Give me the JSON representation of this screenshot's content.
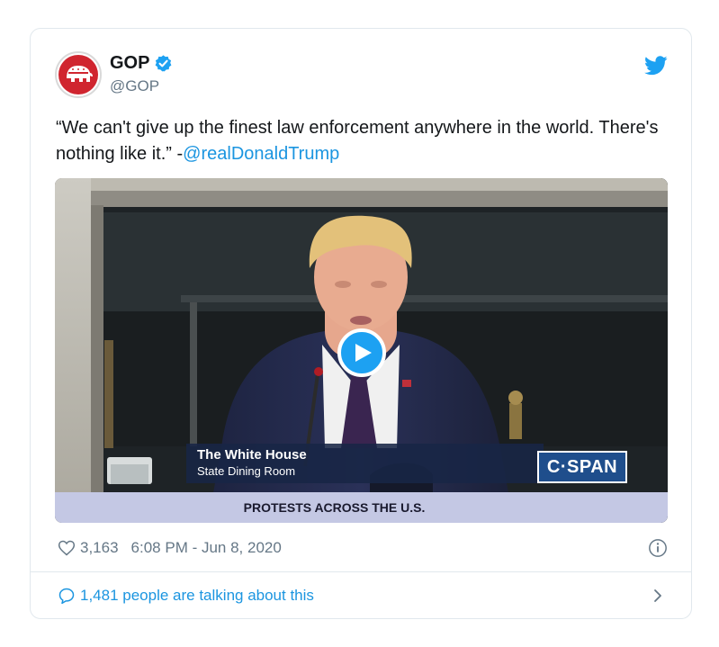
{
  "tweet": {
    "display_name": "GOP",
    "handle": "@GOP",
    "text_part1": "“We can't give up the finest law enforcement anywhere in the world. There's nothing like it.” -",
    "mention": "@realDonaldTrump",
    "like_count": "3,163",
    "timestamp": "6:08 PM - Jun 8, 2020",
    "conversation_label": "1,481 people are talking about this"
  },
  "media": {
    "lower_third_location": "The White House",
    "lower_third_room": "State Dining Room",
    "network_badge": "C·SPAN",
    "ticker_text": "PROTESTS ACROSS THE U.S."
  },
  "icons": {
    "avatar": "gop-elephant-logo",
    "verified": "verified-badge-icon",
    "brand": "twitter-bird-icon",
    "play": "play-icon",
    "like": "heart-icon",
    "info": "info-icon",
    "conversation": "speech-bubble-icon",
    "chevron": "chevron-right-icon"
  },
  "colors": {
    "link": "#1b95e0",
    "twitter_blue": "#1da1f2",
    "secondary_text": "#657786",
    "border": "#e1e8ed",
    "gop_red": "#d0252f"
  }
}
